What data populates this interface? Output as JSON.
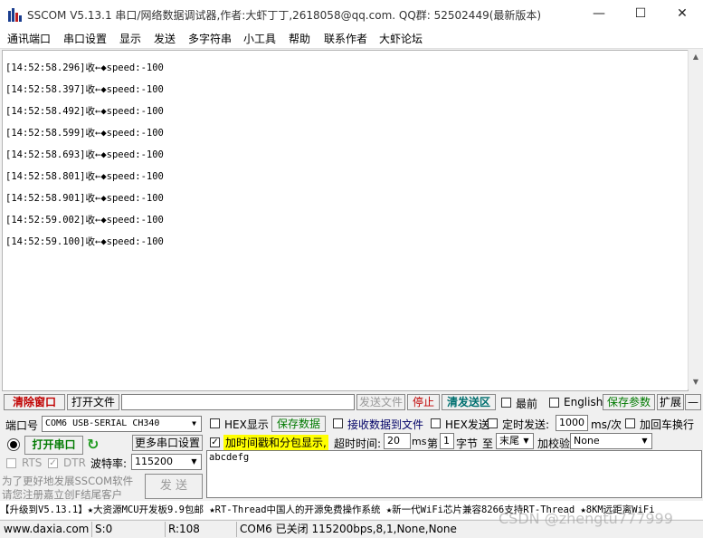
{
  "window": {
    "title": "SSCOM V5.13.1 串口/网络数据调试器,作者:大虾丁丁,2618058@qq.com. QQ群: 52502449(最新版本)",
    "minimize": "—",
    "maximize": "☐",
    "close": "✕"
  },
  "menu": [
    "通讯端口",
    "串口设置",
    "显示",
    "发送",
    "多字符串",
    "小工具",
    "帮助",
    "联系作者",
    "大虾论坛"
  ],
  "log": [
    "[14:52:58.296]收←◆speed:-100",
    "[14:52:58.397]收←◆speed:-100",
    "[14:52:58.492]收←◆speed:-100",
    "[14:52:58.599]收←◆speed:-100",
    "[14:52:58.693]收←◆speed:-100",
    "[14:52:58.801]收←◆speed:-100",
    "[14:52:58.901]收←◆speed:-100",
    "[14:52:59.002]收←◆speed:-100",
    "[14:52:59.100]收←◆speed:-100"
  ],
  "toolbar1": {
    "clear": "清除窗口",
    "open_file": "打开文件",
    "file_path": "",
    "send_file": "发送文件",
    "stop": "停止",
    "clear_send": "清发送区",
    "front": "最前",
    "english": "English",
    "save_params": "保存参数",
    "expand": "扩展",
    "collapse": "—"
  },
  "port": {
    "label": "端口号",
    "value": "COM6 USB-SERIAL CH340",
    "open": "打开串口",
    "more": "更多串口设置",
    "rts": "RTS",
    "dtr": "DTR",
    "baud_label": "波特率:",
    "baud": "115200"
  },
  "options": {
    "hex_show": "HEX显示",
    "save_data": "保存数据",
    "recv_to_file": "接收数据到文件",
    "hex_send": "HEX发送",
    "timed_send": "定时发送:",
    "interval": "1000",
    "interval_unit": "ms/次",
    "crlf": "加回车换行",
    "timestamp": "加时间戳和分包显示,",
    "timeout_label": "超时时间:",
    "timeout": "20",
    "timeout_unit": "ms",
    "nth": "第",
    "byte_index": "1",
    "byte_label": "字节",
    "to": "至",
    "tail": "末尾",
    "checksum_label": "加校验",
    "checksum": "None"
  },
  "send_text": "abcdefg",
  "send_button": "发 送",
  "promo": [
    "为了更好地发展SSCOM软件",
    "请您注册嘉立创F结尾客户"
  ],
  "ticker": "【升级到V5.13.1】★大资源MCU开发板9.9包邮 ★RT-Thread中国人的开源免费操作系统 ★新一代WiFi芯片兼容8266支持RT-Thread ★8KM远距离WiFi",
  "status": {
    "site": "www.daxia.com",
    "s": "S:0",
    "r": "R:108",
    "port_state": "COM6 已关闭  115200bps,8,1,None,None"
  },
  "watermark": "CSDN @zhengtu777999",
  "colors": {
    "red_label": "#c00000",
    "green_label": "#007a00",
    "teal_label": "#007070",
    "highlight": "#ffff00"
  }
}
